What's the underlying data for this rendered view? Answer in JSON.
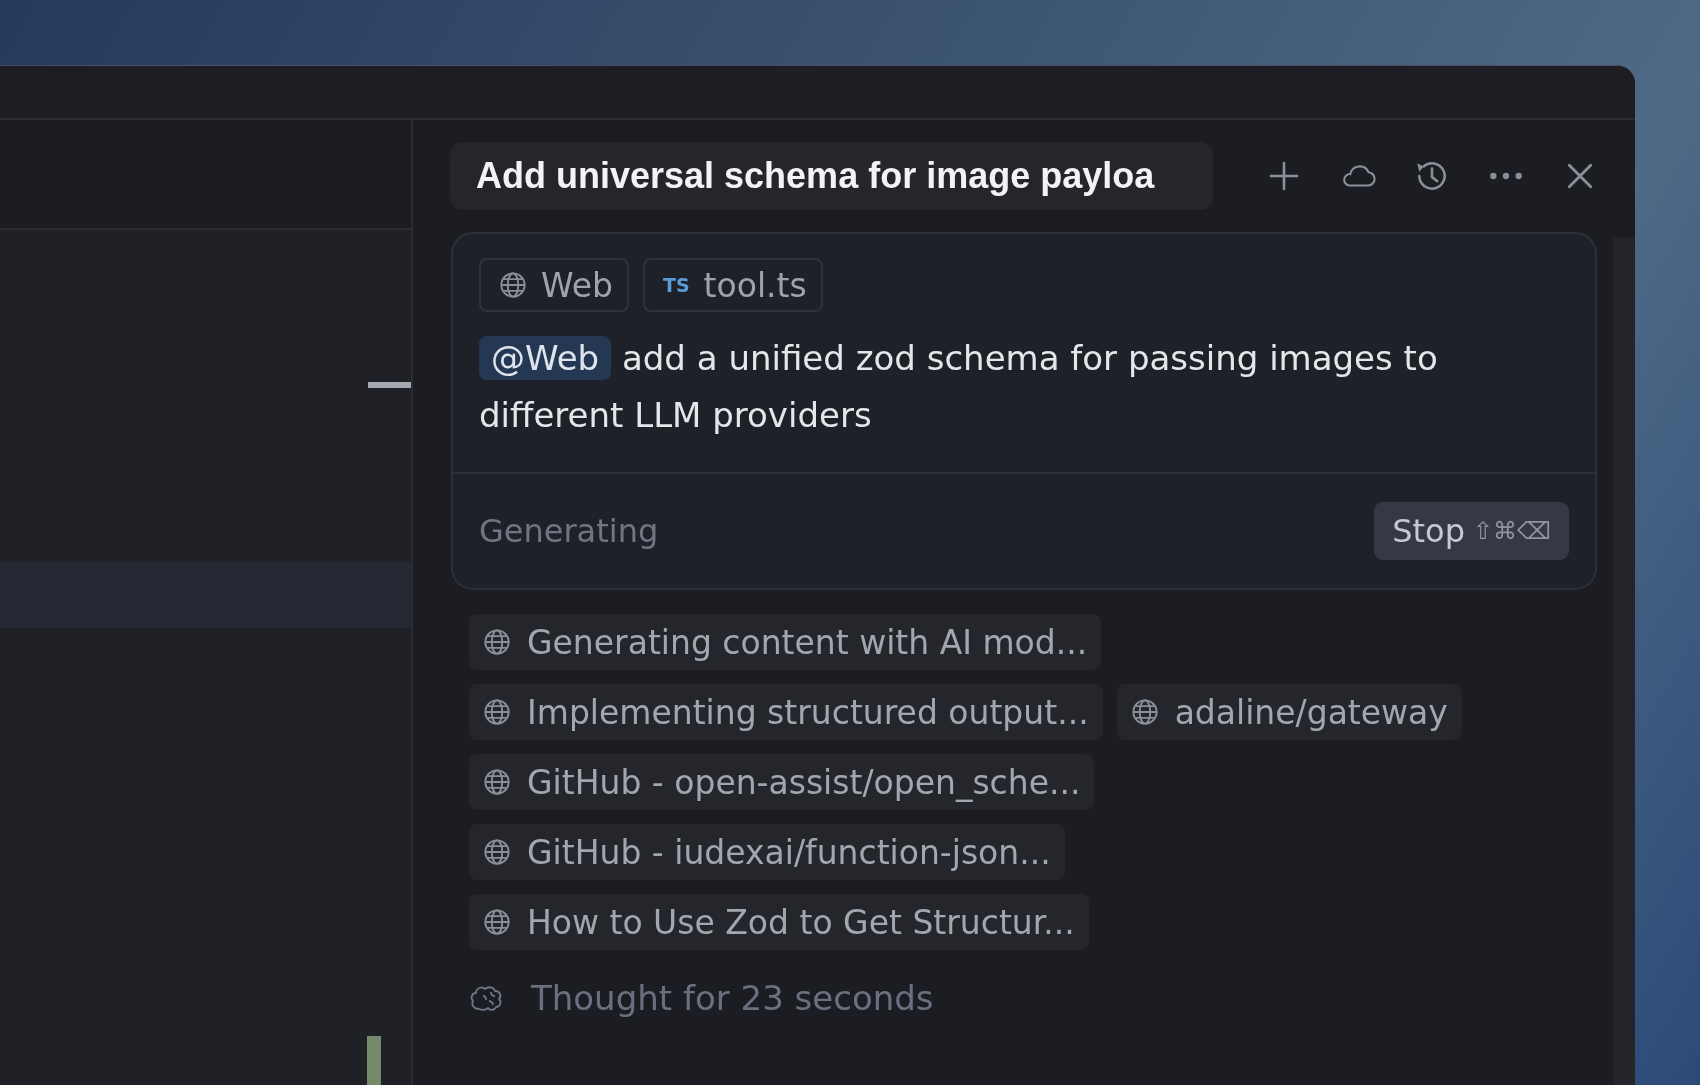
{
  "chat": {
    "title": "Add universal schema for image payloa"
  },
  "context_chips": [
    {
      "kind": "web",
      "label": "Web"
    },
    {
      "kind": "file",
      "badge": "TS",
      "label": "tool.ts"
    }
  ],
  "message": {
    "mention": "@Web",
    "text": "add a unified zod schema for passing images to different LLM providers"
  },
  "composer_footer": {
    "status": "Generating",
    "stop_button": {
      "label": "Stop",
      "shortcut": "⇧⌘⌫"
    }
  },
  "sources": [
    [
      {
        "label": "Generating content with AI mod..."
      }
    ],
    [
      {
        "label": "Implementing structured output..."
      },
      {
        "label": "adaline/gateway"
      }
    ],
    [
      {
        "label": "GitHub - open-assist/open_sche..."
      }
    ],
    [
      {
        "label": "GitHub - iudexai/function-json..."
      }
    ],
    [
      {
        "label": "How to Use Zod to Get Structur..."
      }
    ]
  ],
  "thought": "Thought for 23 seconds"
}
